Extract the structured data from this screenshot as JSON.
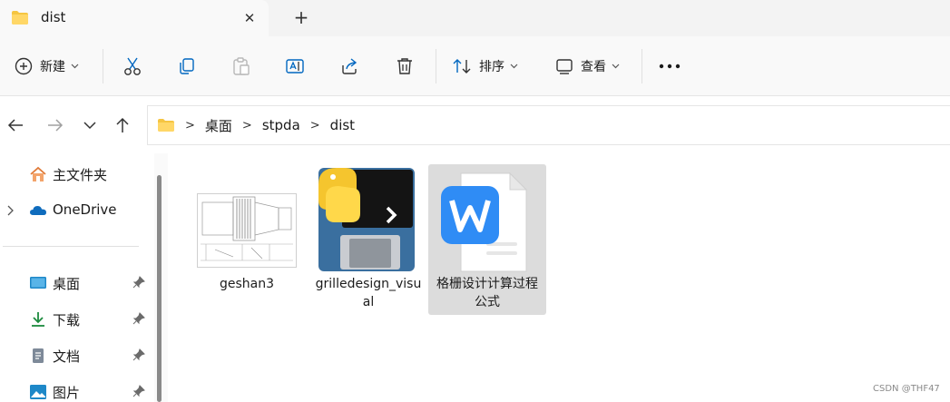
{
  "tab": {
    "title": "dist",
    "close_glyph": "✕",
    "new_tab_glyph": "+"
  },
  "toolbar": {
    "new_label": "新建",
    "sort_label": "排序",
    "view_label": "查看",
    "more_glyph": "···",
    "icons": [
      "cut-icon",
      "copy-icon",
      "paste-icon",
      "rename-icon",
      "share-icon",
      "delete-icon"
    ]
  },
  "nav": {
    "back_glyph": "←",
    "forward_glyph": "→",
    "recent_glyph": "⌄",
    "up_glyph": "↑"
  },
  "breadcrumb": [
    "桌面",
    "stpda",
    "dist"
  ],
  "sidebar": {
    "home": "主文件夹",
    "onedrive": "OneDrive",
    "quick": [
      {
        "label": "桌面"
      },
      {
        "label": "下载"
      },
      {
        "label": "文档"
      },
      {
        "label": "图片"
      }
    ]
  },
  "files": [
    {
      "name": "geshan3",
      "type": "image"
    },
    {
      "name": "grilledesign_visual",
      "type": "python"
    },
    {
      "name": "格栅设计计算过程公式",
      "type": "wps",
      "selected": true
    }
  ],
  "watermark": "CSDN @THF47",
  "colors": {
    "folder": "#f5c542",
    "accent": "#0067c0",
    "selection": "#dcdcdc",
    "wps_blue": "#2f8cf5"
  }
}
